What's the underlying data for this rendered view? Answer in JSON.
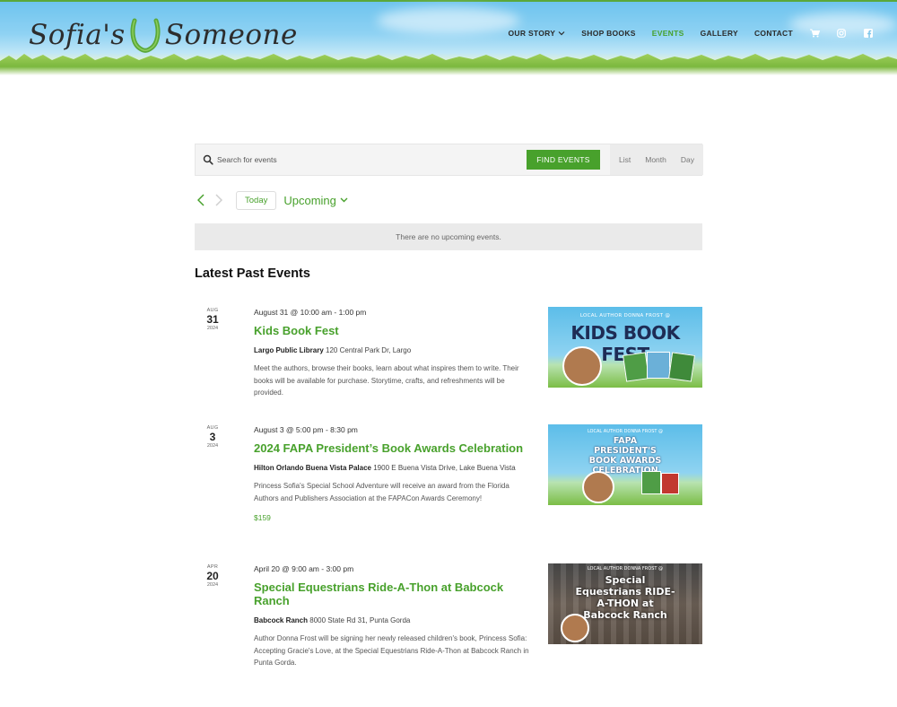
{
  "site": {
    "logo_left": "Sofia's",
    "logo_right": "Someone",
    "nav": [
      {
        "label": "OUR STORY",
        "has_dropdown": true
      },
      {
        "label": "SHOP BOOKS"
      },
      {
        "label": "EVENTS",
        "active": true
      },
      {
        "label": "GALLERY"
      },
      {
        "label": "CONTACT"
      }
    ],
    "icons": [
      "cart-icon",
      "instagram-icon",
      "facebook-icon"
    ],
    "accent_color": "#48a12c"
  },
  "search": {
    "placeholder": "Search for events",
    "button_label": "FIND EVENTS",
    "views": [
      "List",
      "Month",
      "Day"
    ]
  },
  "date_nav": {
    "today_label": "Today",
    "range_label": "Upcoming"
  },
  "notice": "There are no upcoming events.",
  "section_title": "Latest Past Events",
  "events": [
    {
      "month": "AUG",
      "day": "31",
      "year": "2024",
      "time": "August 31 @ 10:00 am - 1:00 pm",
      "title": "Kids Book Fest",
      "venue_name": "Largo Public Library",
      "venue_address": "120 Central Park Dr, Largo",
      "description": "Meet the authors, browse their books, learn about what inspires them to write. Their books will be available for purchase. Storytime, crafts, and refreshments will be provided.",
      "cost": "",
      "image_kicker": "LOCAL AUTHOR DONNA FROST @",
      "image_title": "KIDS BOOK FEST"
    },
    {
      "month": "AUG",
      "day": "3",
      "year": "2024",
      "time": "August 3 @ 5:00 pm - 8:30 pm",
      "title": "2024 FAPA President’s Book Awards Celebration",
      "venue_name": "Hilton Orlando Buena Vista Palace",
      "venue_address": "1900 E Buena Vista Drive, Lake Buena Vista",
      "description": "Princess Sofia's Special School Adventure will receive an award from the Florida Authors and Publishers Association at the FAPACon Awards Ceremony!",
      "cost": "$159",
      "image_kicker": "LOCAL AUTHOR DONNA FROST @",
      "image_title": "FAPA PRESIDENT'S BOOK AWARDS CELEBRATION"
    },
    {
      "month": "APR",
      "day": "20",
      "year": "2024",
      "time": "April 20 @ 9:00 am - 3:00 pm",
      "title": "Special Equestrians Ride-A-Thon at Babcock Ranch",
      "venue_name": "Babcock Ranch",
      "venue_address": "8000 State Rd 31, Punta Gorda",
      "description": "Author Donna Frost will be signing her newly released children's book, Princess Sofia: Accepting Gracie's Love, at the Special Equestrians Ride-A-Thon at Babcock Ranch in Punta Gorda.",
      "cost": "",
      "image_kicker": "LOCAL AUTHOR DONNA FROST @",
      "image_title": "Special Equestrians RIDE-A-THON at Babcock Ranch"
    }
  ]
}
